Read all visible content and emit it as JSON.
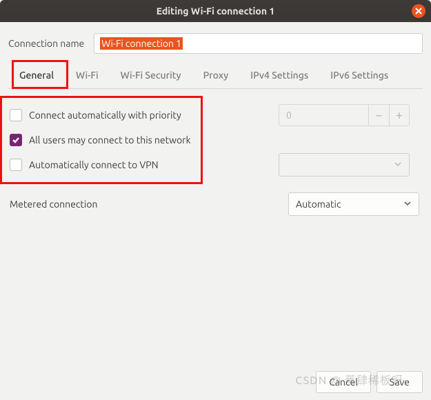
{
  "titlebar": {
    "title": "Editing Wi-Fi connection 1"
  },
  "connection": {
    "label": "Connection name",
    "value": "Wi-Fi connection 1"
  },
  "tabs": {
    "items": [
      {
        "label": "General"
      },
      {
        "label": "Wi-Fi"
      },
      {
        "label": "Wi-Fi Security"
      },
      {
        "label": "Proxy"
      },
      {
        "label": "IPv4 Settings"
      },
      {
        "label": "IPv6 Settings"
      }
    ],
    "active_index": 0
  },
  "general": {
    "opt_auto_priority": {
      "label": "Connect automatically with priority",
      "checked": false,
      "priority_value": "0"
    },
    "opt_all_users": {
      "label": "All users may connect to this network",
      "checked": true
    },
    "opt_auto_vpn": {
      "label": "Automatically connect to VPN",
      "checked": false,
      "vpn_selected": ""
    },
    "metered": {
      "label": "Metered connection",
      "value": "Automatic"
    }
  },
  "footer": {
    "cancel": "Cancel",
    "save": "Save"
  },
  "watermark": "CSDN @ 蕉肆稀板呀"
}
